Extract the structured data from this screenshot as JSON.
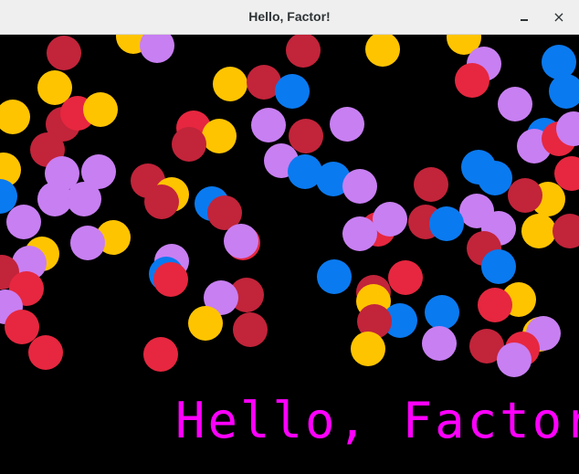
{
  "window": {
    "title": "Hello, Factor!",
    "minimize_icon": "minimize-icon",
    "close_icon": "close-icon",
    "close_glyph": "×"
  },
  "canvas": {
    "background": "#000000",
    "message": "Hello, Factor!",
    "message_color": "#ff00ff",
    "palette": {
      "violet": "#c87ff2",
      "crimson": "#c2243a",
      "red": "#e6273f",
      "yellow": "#ffc400",
      "blue": "#0a7af0"
    }
  }
}
